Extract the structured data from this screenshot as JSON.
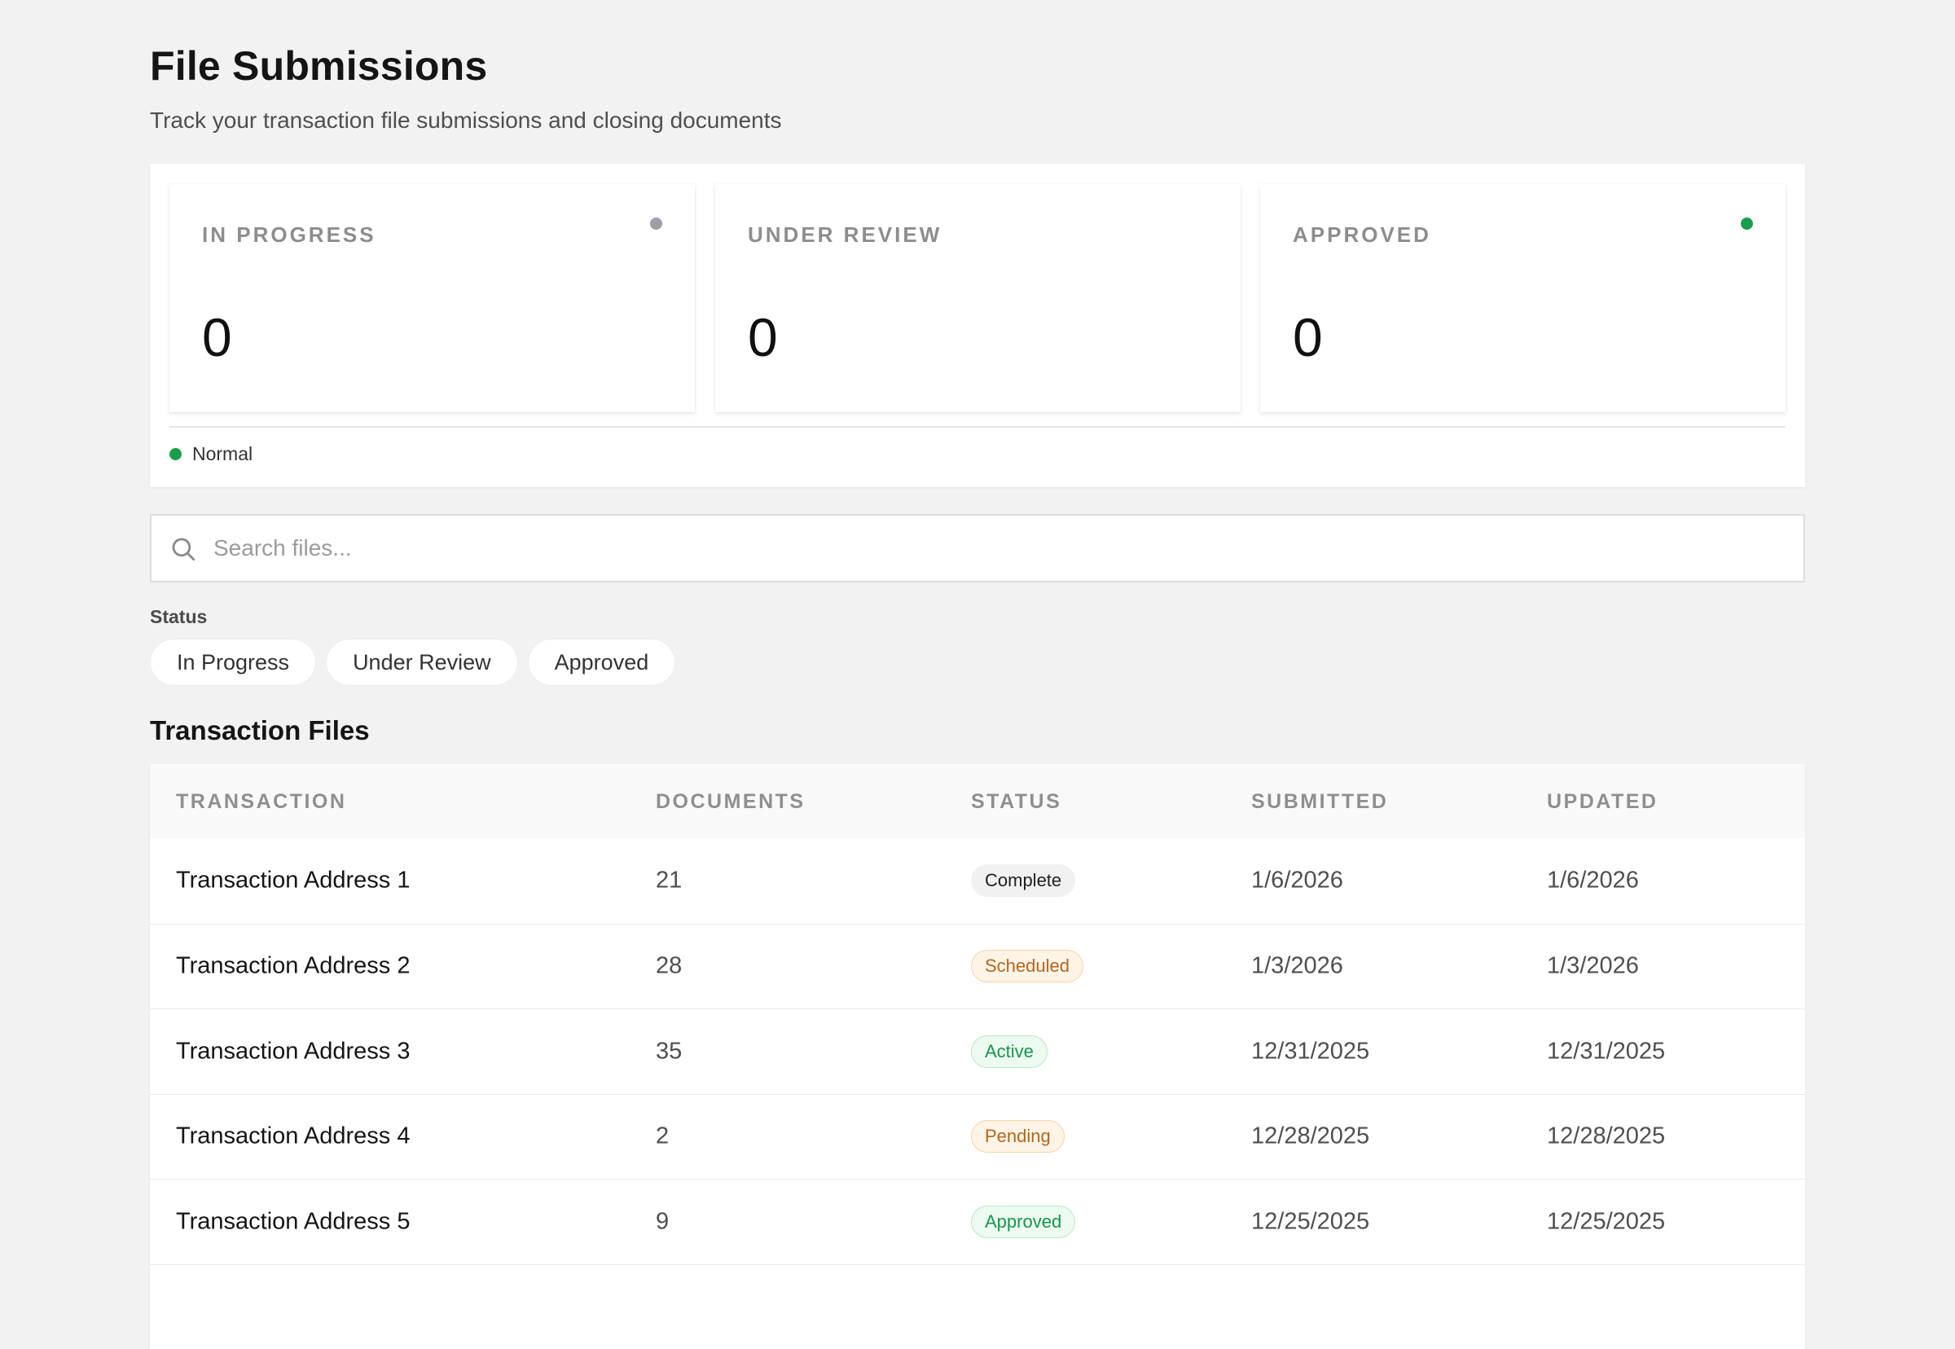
{
  "header": {
    "title": "File Submissions",
    "subtitle": "Track your transaction file submissions and closing documents"
  },
  "stats": [
    {
      "label": "IN PROGRESS",
      "value": "0",
      "dot_color": "#9aa0a6"
    },
    {
      "label": "UNDER REVIEW",
      "value": "0",
      "dot_color": null
    },
    {
      "label": "APPROVED",
      "value": "0",
      "dot_color": "#1a9e4b"
    }
  ],
  "legend": {
    "label": "Normal",
    "color": "#1a9e4b"
  },
  "search": {
    "placeholder": "Search files...",
    "value": "",
    "icon": "search-icon"
  },
  "filters": {
    "label": "Status",
    "options": [
      "In Progress",
      "Under Review",
      "Approved"
    ]
  },
  "table": {
    "title": "Transaction Files",
    "columns": [
      "TRANSACTION",
      "DOCUMENTS",
      "STATUS",
      "SUBMITTED",
      "UPDATED"
    ],
    "rows": [
      {
        "transaction": "Transaction Address 1",
        "documents": "21",
        "status": "Complete",
        "status_kind": "neutral",
        "submitted": "1/6/2026",
        "updated": "1/6/2026"
      },
      {
        "transaction": "Transaction Address 2",
        "documents": "28",
        "status": "Scheduled",
        "status_kind": "warn",
        "submitted": "1/3/2026",
        "updated": "1/3/2026"
      },
      {
        "transaction": "Transaction Address 3",
        "documents": "35",
        "status": "Active",
        "status_kind": "success",
        "submitted": "12/31/2025",
        "updated": "12/31/2025"
      },
      {
        "transaction": "Transaction Address 4",
        "documents": "2",
        "status": "Pending",
        "status_kind": "warn",
        "submitted": "12/28/2025",
        "updated": "12/28/2025"
      },
      {
        "transaction": "Transaction Address 5",
        "documents": "9",
        "status": "Approved",
        "status_kind": "success",
        "submitted": "12/25/2025",
        "updated": "12/25/2025"
      },
      {
        "transaction": "",
        "documents": "",
        "status": "",
        "status_kind": "",
        "submitted": "",
        "updated": ""
      }
    ]
  }
}
